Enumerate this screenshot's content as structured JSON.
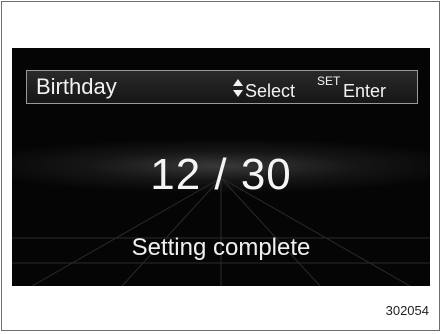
{
  "header": {
    "title": "Birthday",
    "select_icon": "up-down-arrows-icon",
    "select_label": "Select",
    "set_label": "SET",
    "enter_label": "Enter"
  },
  "main": {
    "date_value": "12 / 30",
    "status": "Setting complete"
  },
  "figure": {
    "id": "302054"
  },
  "colors": {
    "screen_background": "#050505",
    "text": "#f2f2f2",
    "header_border": "#9a9a9a"
  }
}
